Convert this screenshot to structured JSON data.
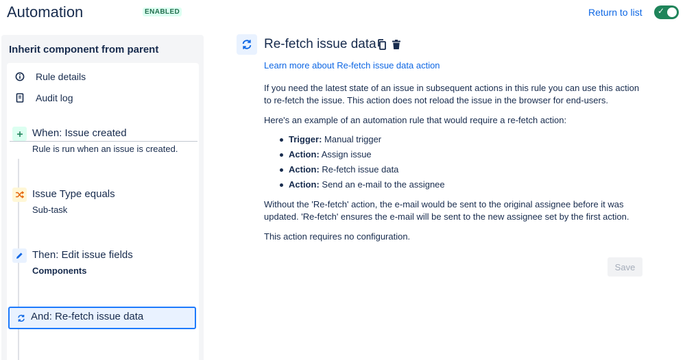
{
  "header": {
    "title": "Automation",
    "badge": "ENABLED",
    "return_link": "Return to list",
    "toggle_on": true
  },
  "sidebar": {
    "heading": "Inherit component from parent",
    "nav": [
      {
        "label": "Rule details",
        "icon": "info-icon"
      },
      {
        "label": "Audit log",
        "icon": "document-icon"
      }
    ],
    "steps": [
      {
        "title": "When: Issue created",
        "subtitle": "Rule is run when an issue is created.",
        "icon": "plus-icon",
        "kind": "trigger"
      },
      {
        "title": "Issue Type equals",
        "subtitle": "Sub-task",
        "icon": "shuffle-icon",
        "kind": "condition"
      },
      {
        "title": "Then: Edit issue fields",
        "subtitle": "Components",
        "icon": "pencil-icon",
        "kind": "action"
      },
      {
        "title": "And: Re-fetch issue data",
        "subtitle": "",
        "icon": "refresh-icon",
        "kind": "action",
        "selected": true
      }
    ]
  },
  "main": {
    "title": "Re-fetch issue data",
    "learn_link": "Learn more about Re-fetch issue data action",
    "para1": "If you need the latest state of an issue in subsequent actions in this rule you can use this action to re-fetch the issue. This action does not reload the issue in the browser for end-users.",
    "para2": "Here's an example of an automation rule that would require a re-fetch action:",
    "bullets": [
      {
        "label": "Trigger:",
        "text": "Manual trigger"
      },
      {
        "label": "Action:",
        "text": "Assign issue"
      },
      {
        "label": "Action:",
        "text": "Re-fetch issue data"
      },
      {
        "label": "Action:",
        "text": "Send an e-mail to the assignee"
      }
    ],
    "para3": "Without the 'Re-fetch' action, the e-mail would be sent to the original assignee before it was updated. 'Re-fetch' ensures the e-mail will be sent to the new assignee set by the first action.",
    "para4": "This action requires no configuration.",
    "save_label": "Save"
  },
  "colors": {
    "accent": "#0c66e4",
    "enabled_green": "#1f845a",
    "selected_border": "#1d7afc",
    "sidebar_bg": "#f4f5f7"
  }
}
